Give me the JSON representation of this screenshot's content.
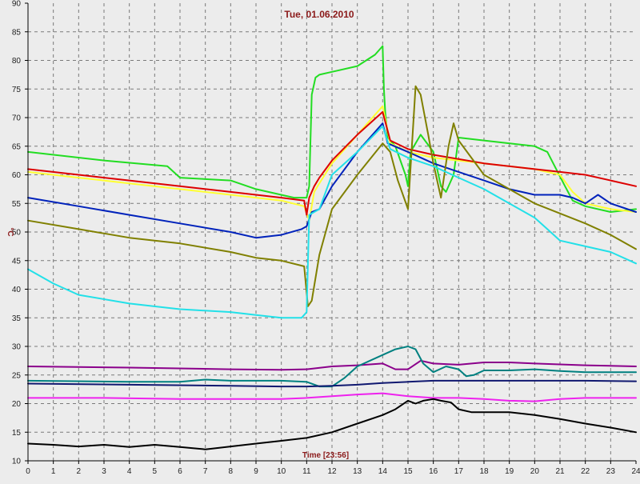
{
  "chart_data": {
    "type": "line",
    "title": "Tue, 01.06.2010",
    "xlabel": "Time [23:56]",
    "ylabel": "°C",
    "xlim": [
      0,
      24
    ],
    "ylim": [
      10,
      90
    ],
    "x_ticks": [
      "0",
      "1",
      "2",
      "3",
      "4",
      "5",
      "6",
      "7",
      "8",
      "9",
      "10",
      "11",
      "12",
      "13",
      "14",
      "15",
      "16",
      "17",
      "18",
      "19",
      "20",
      "21",
      "22",
      "23",
      "24"
    ],
    "y_ticks": [
      "10",
      "15",
      "20",
      "25",
      "30",
      "35",
      "40",
      "45",
      "50",
      "55",
      "60",
      "65",
      "70",
      "75",
      "80",
      "85",
      "90"
    ],
    "grid": true,
    "colors": {
      "background": "#ececec",
      "grid": "#7a7a7a",
      "title": "#8b1a1a"
    },
    "series": [
      {
        "color": "#22dd22",
        "x": [
          0,
          3,
          5.5,
          6,
          8,
          9,
          10.5,
          11,
          11.1,
          11.2,
          11.35,
          11.5,
          12,
          13,
          13.7,
          14.0,
          14.05,
          14.1,
          14.2,
          14.5,
          14.9,
          15,
          15.1,
          15.5,
          16.0,
          16.3,
          16.5,
          16.8,
          17,
          18,
          20,
          20.5,
          21.2,
          21.5,
          22,
          23,
          24
        ],
        "y": [
          64,
          62.5,
          61.5,
          59.5,
          59,
          57.5,
          56,
          56,
          58,
          74,
          77,
          77.5,
          78,
          79,
          81,
          82.5,
          75,
          71,
          66.5,
          65,
          60,
          58,
          64,
          67,
          64,
          58,
          57,
          60,
          66.5,
          66,
          65,
          64,
          58,
          55.5,
          54.5,
          53.5,
          54
        ]
      },
      {
        "color": "#ffff33",
        "x": [
          0,
          2,
          4,
          6,
          8,
          10,
          10.9,
          11.1,
          11.3,
          11.5,
          12,
          13,
          14.0,
          14.3,
          15,
          16,
          18,
          20,
          21,
          21.5,
          22,
          23,
          24
        ],
        "y": [
          60.5,
          59.5,
          58.5,
          57.5,
          56.5,
          55.5,
          54.5,
          52,
          57,
          58.5,
          62,
          67,
          72,
          65.5,
          64,
          63,
          62,
          61,
          60,
          57,
          55,
          54,
          53.5
        ]
      },
      {
        "color": "#dd0000",
        "x": [
          0,
          2,
          4,
          6,
          8,
          10,
          10.9,
          11.0,
          11.1,
          11.3,
          11.5,
          12,
          13,
          14.0,
          14.3,
          15,
          16,
          18,
          20,
          21,
          22,
          23,
          24
        ],
        "y": [
          61,
          60,
          59,
          58,
          57,
          56,
          55.5,
          53,
          56,
          58,
          59.5,
          62.5,
          67,
          71,
          66,
          64.5,
          63.5,
          62,
          61,
          60.5,
          60,
          59,
          58
        ]
      },
      {
        "color": "#0022bb",
        "x": [
          0,
          2,
          4,
          6,
          8,
          9,
          10,
          10.8,
          11.0,
          11.2,
          11.5,
          12,
          13,
          14.0,
          14.2,
          15,
          16,
          17,
          18,
          19,
          20,
          21,
          21.5,
          22,
          22.5,
          23,
          24
        ],
        "y": [
          56,
          54.5,
          53,
          51.5,
          50,
          49,
          49.5,
          50.5,
          51,
          53.5,
          54,
          58,
          64,
          69,
          65.5,
          64,
          62,
          60.5,
          59,
          57.5,
          56.5,
          56.5,
          56,
          55,
          56.5,
          55,
          53.5
        ]
      },
      {
        "color": "#808000",
        "x": [
          0,
          2,
          4,
          6,
          8,
          9,
          10,
          10.9,
          11.05,
          11.2,
          11.5,
          12,
          13,
          14.0,
          14.3,
          14.6,
          15.0,
          15.3,
          15.5,
          15.8,
          16.0,
          16.3,
          16.6,
          16.8,
          17.0,
          17.5,
          18,
          20,
          22,
          23,
          24
        ],
        "y": [
          52,
          50.5,
          49,
          48,
          46.5,
          45.5,
          45,
          44,
          37,
          38,
          46,
          54,
          60,
          65.5,
          64,
          59,
          54,
          75.5,
          74,
          67,
          62,
          56,
          65,
          69,
          66,
          63,
          60,
          55,
          51.5,
          49.5,
          47
        ]
      },
      {
        "color": "#22e0e8",
        "x": [
          0,
          1,
          2,
          4,
          6,
          8,
          9,
          10,
          10.8,
          11.0,
          11.1,
          11.5,
          12,
          13,
          14.0,
          14.3,
          15,
          16,
          17,
          18,
          19,
          20,
          20.5,
          21,
          22,
          23,
          24
        ],
        "y": [
          43.5,
          41,
          39,
          37.5,
          36.5,
          36,
          35.5,
          35,
          35,
          36,
          53,
          54,
          60,
          64,
          68.5,
          64.5,
          63,
          61.5,
          59.5,
          57.5,
          55,
          52.5,
          50.5,
          48.5,
          47.5,
          46.5,
          44.5
        ]
      },
      {
        "color": "#8b008b",
        "x": [
          0,
          4,
          8,
          10,
          11,
          12,
          13,
          14,
          14.5,
          15,
          15.5,
          16,
          17,
          18,
          19,
          20,
          22,
          24
        ],
        "y": [
          26.5,
          26.3,
          26,
          25.9,
          26,
          26.5,
          26.7,
          27,
          26,
          26,
          27.5,
          27,
          26.8,
          27.2,
          27.2,
          27,
          26.7,
          26.5
        ]
      },
      {
        "color": "#008080",
        "x": [
          0,
          4,
          6,
          7,
          8,
          10,
          11,
          11.5,
          12,
          12.5,
          13,
          14,
          14.5,
          15,
          15.3,
          15.6,
          16,
          16.5,
          17,
          17.3,
          17.6,
          18,
          19,
          20,
          21,
          22,
          23,
          24
        ],
        "y": [
          24,
          23.8,
          23.8,
          24.2,
          24,
          24,
          23.8,
          23,
          23,
          24.5,
          26.5,
          28.5,
          29.5,
          30,
          29.5,
          27,
          25.5,
          26.5,
          26,
          24.8,
          25,
          25.8,
          25.8,
          26,
          25.7,
          25.5,
          25.5,
          25.5
        ]
      },
      {
        "color": "#101870",
        "x": [
          0,
          4,
          8,
          10,
          11,
          12,
          13,
          14,
          15,
          16,
          18,
          20,
          22,
          24
        ],
        "y": [
          23.5,
          23.3,
          23.1,
          23,
          23,
          23.1,
          23.3,
          23.6,
          23.8,
          24,
          24,
          24,
          24,
          23.9
        ]
      },
      {
        "color": "#ee22ee",
        "x": [
          0,
          3,
          6,
          9,
          10,
          11,
          12,
          13,
          14,
          15,
          16,
          17,
          18,
          19,
          20,
          21,
          22,
          23,
          24
        ],
        "y": [
          21,
          21,
          20.8,
          20.8,
          20.8,
          21,
          21.3,
          21.6,
          21.8,
          21.3,
          21,
          21,
          20.8,
          20.5,
          20.4,
          20.8,
          21,
          21,
          21
        ]
      },
      {
        "color": "#000000",
        "x": [
          0,
          1,
          2,
          3,
          4,
          5,
          6,
          7,
          8,
          9,
          10,
          11,
          12,
          13,
          14,
          14.5,
          15,
          15.3,
          15.6,
          16,
          16.3,
          16.7,
          17,
          17.5,
          18,
          19,
          20,
          21,
          22,
          23,
          24
        ],
        "y": [
          13,
          12.8,
          12.5,
          12.8,
          12.4,
          12.8,
          12.4,
          12,
          12.5,
          13,
          13.5,
          14,
          15,
          16.5,
          18,
          19,
          20.5,
          20,
          20.5,
          20.8,
          20.5,
          20.2,
          19,
          18.5,
          18.5,
          18.5,
          18,
          17.3,
          16.5,
          15.8,
          15
        ]
      }
    ]
  }
}
